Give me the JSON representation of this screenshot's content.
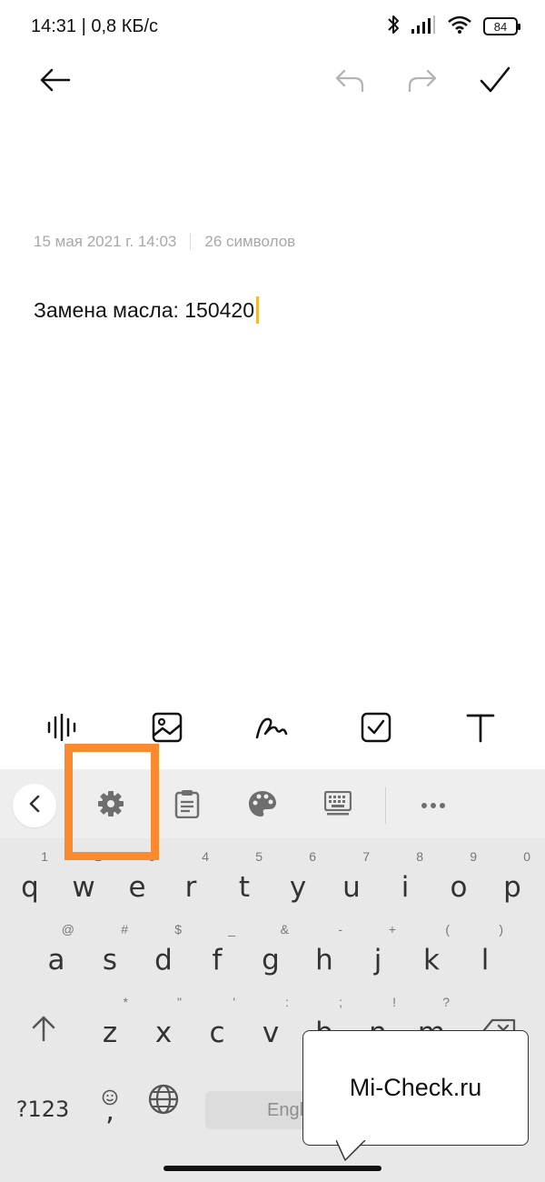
{
  "status_bar": {
    "time": "14:31 | 0,8 КБ/с",
    "battery": "84"
  },
  "topbar": {
    "back_icon": "arrow-left-icon",
    "undo_icon": "undo-icon",
    "redo_icon": "redo-icon",
    "done_icon": "checkmark-icon"
  },
  "note": {
    "date": "15 мая 2021 г.  14:03",
    "char_count": "26 символов",
    "text": "Замена масла: 150420"
  },
  "note_toolbar": [
    "voice-waveform-icon",
    "image-icon",
    "handwriting-icon",
    "checklist-icon",
    "text-format-icon"
  ],
  "keyboard": {
    "toolbar": [
      "chevron-left-icon",
      "gear-icon",
      "clipboard-icon",
      "palette-icon",
      "keyboard-icon",
      "more-icon"
    ],
    "row1": [
      {
        "k": "q",
        "h": "1"
      },
      {
        "k": "w",
        "h": "2"
      },
      {
        "k": "e",
        "h": "3"
      },
      {
        "k": "r",
        "h": "4"
      },
      {
        "k": "t",
        "h": "5"
      },
      {
        "k": "y",
        "h": "6"
      },
      {
        "k": "u",
        "h": "7"
      },
      {
        "k": "i",
        "h": "8"
      },
      {
        "k": "o",
        "h": "9"
      },
      {
        "k": "p",
        "h": "0"
      }
    ],
    "row2": [
      {
        "k": "a",
        "h": "@"
      },
      {
        "k": "s",
        "h": "#"
      },
      {
        "k": "d",
        "h": "$"
      },
      {
        "k": "f",
        "h": "_"
      },
      {
        "k": "g",
        "h": "&"
      },
      {
        "k": "h",
        "h": "-"
      },
      {
        "k": "j",
        "h": "+"
      },
      {
        "k": "k",
        "h": "("
      },
      {
        "k": "l",
        "h": ")"
      }
    ],
    "row3": [
      {
        "k": "z",
        "h": "*"
      },
      {
        "k": "x",
        "h": "\""
      },
      {
        "k": "c",
        "h": "'"
      },
      {
        "k": "v",
        "h": ":"
      },
      {
        "k": "b",
        "h": ";"
      },
      {
        "k": "n",
        "h": "!"
      },
      {
        "k": "m",
        "h": "?"
      }
    ],
    "shift_icon": "shift-arrow-icon",
    "backspace_icon": "backspace-icon",
    "numbers_label": "?123",
    "emoji_icon": "emoji-icon",
    "comma_label": ",",
    "globe_icon": "globe-icon",
    "space_label": "English"
  },
  "callout": {
    "text": "Mi-Check.ru"
  },
  "colors": {
    "highlight": "#fb8a2e",
    "cursor": "#f4b73a",
    "keyboard_bg": "#e8e8e8"
  }
}
